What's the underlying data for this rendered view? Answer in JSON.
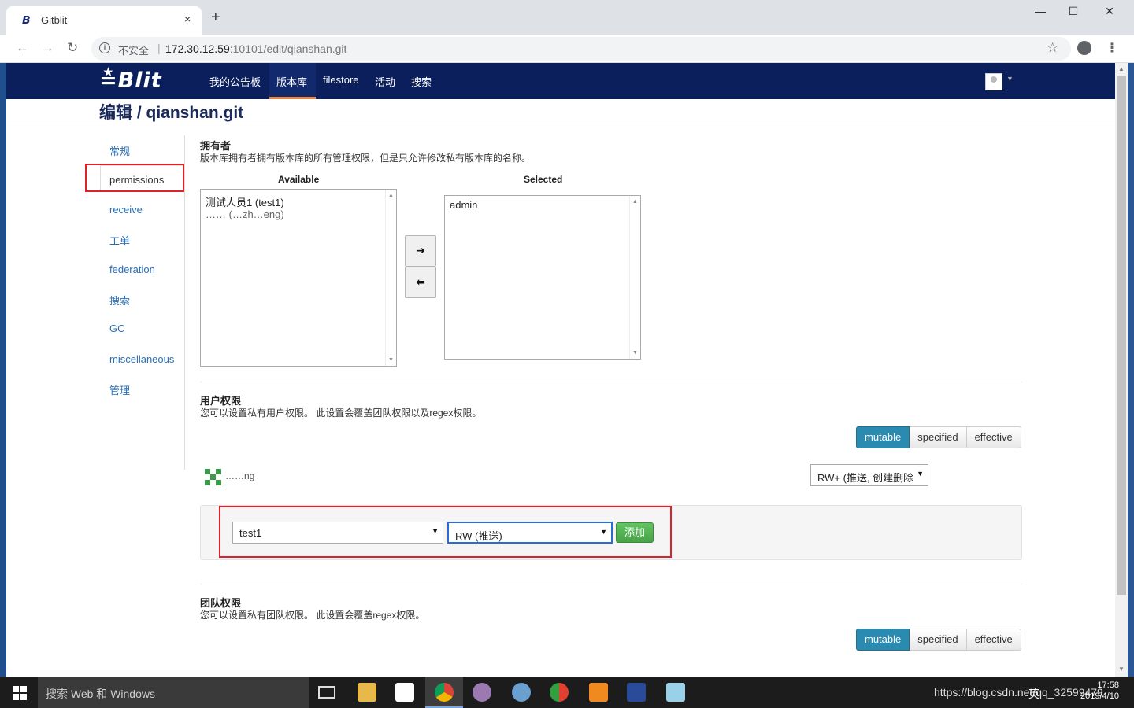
{
  "browser": {
    "tab_title": "Gitblit",
    "tab_favicon": "𝘽",
    "tab_close": "×",
    "new_tab": "+",
    "minimize": "—",
    "maximize": "☐",
    "close": "✕",
    "insecure_label": "不安全",
    "url_host": "172.30.12.59",
    "url_rest": ":10101/edit/qianshan.git"
  },
  "navbar": {
    "logo": "≛Blit",
    "items": [
      "我的公告板",
      "版本库",
      "filestore",
      "活动",
      "搜索"
    ],
    "active_item": "版本库"
  },
  "page_title": "编辑 / qianshan.git",
  "sidebar": {
    "items": [
      "常规",
      "permissions",
      "receive",
      "工单",
      "federation",
      "搜索",
      "GC",
      "miscellaneous",
      "管理"
    ],
    "active_item": "permissions"
  },
  "owners": {
    "heading": "拥有者",
    "description": "版本库拥有者拥有版本库的所有管理权限，但是只允许修改私有版本库的名称。",
    "available_label": "Available",
    "selected_label": "Selected",
    "available": [
      "测试人员1 (test1)",
      "…… (…zh…eng)"
    ],
    "selected": [
      "admin"
    ],
    "move_right": "➔",
    "move_left": "⬅"
  },
  "user_permissions": {
    "heading": "用户权限",
    "description": "您可以设置私有用户权限。 此设置会覆盖团队权限以及regex权限。",
    "modes": [
      "mutable",
      "specified",
      "effective"
    ],
    "active_mode": "mutable",
    "existing_user": "……ng",
    "existing_permission": "RW+ (推送, 创建删除",
    "new_user_value": "test1",
    "new_permission_value": "RW (推送)",
    "add_label": "添加"
  },
  "team_permissions": {
    "heading": "团队权限",
    "description": "您可以设置私有团队权限。 此设置会覆盖regex权限。",
    "modes": [
      "mutable",
      "specified",
      "effective"
    ],
    "active_mode": "mutable"
  },
  "taskbar": {
    "search_placeholder": "搜索 Web 和 Windows",
    "tray_text": "https://blog.csdn.net/qq_32599479",
    "ime": "英",
    "time": "17:58",
    "date": "2019/4/10"
  },
  "colors": {
    "navbar": "#0b1f5c",
    "nav_active": "#f0843c",
    "link": "#2a70b8",
    "mode_active": "#2a8ab0",
    "add_button": "#4aa24a",
    "highlight": "#e0202a"
  }
}
